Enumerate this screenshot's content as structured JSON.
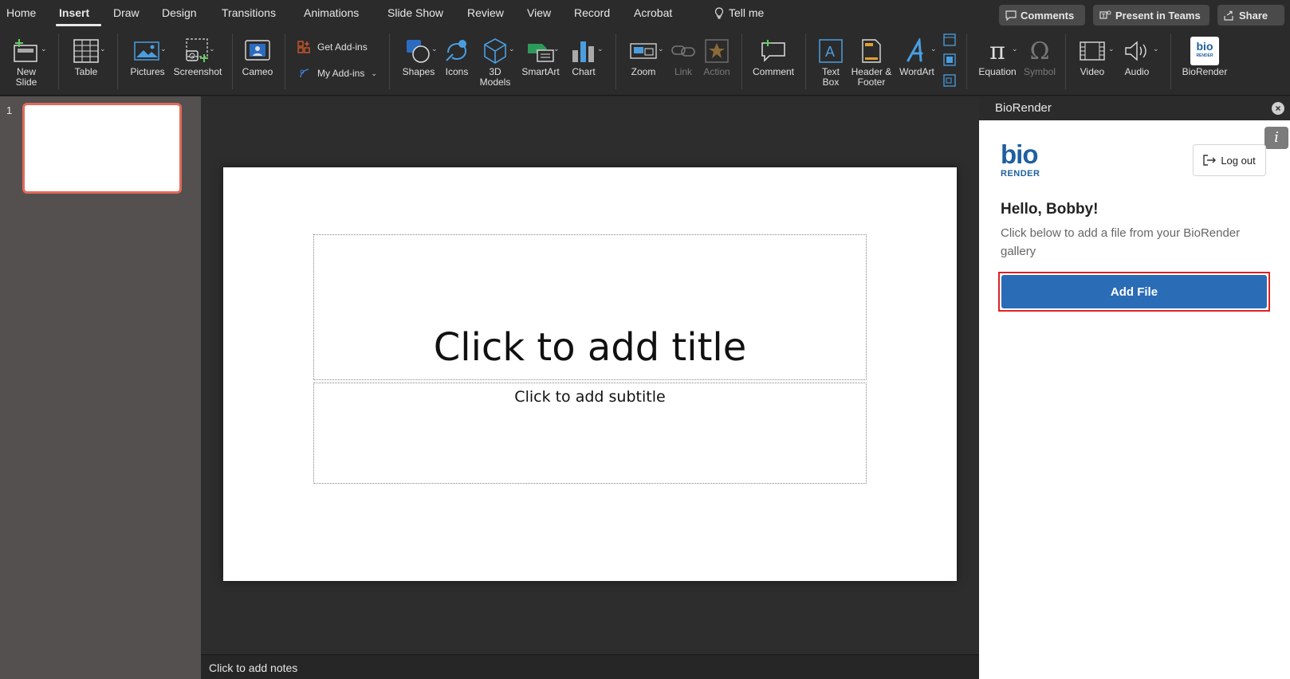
{
  "tabs": [
    "Home",
    "Insert",
    "Draw",
    "Design",
    "Transitions",
    "Animations",
    "Slide Show",
    "Review",
    "View",
    "Record",
    "Acrobat"
  ],
  "tell_me": "Tell me",
  "topbar": {
    "comments": "Comments",
    "present_in_teams": "Present in Teams",
    "share": "Share"
  },
  "ribbon": {
    "new_slide": [
      "New",
      "Slide"
    ],
    "table": "Table",
    "pictures": "Pictures",
    "screenshot": "Screenshot",
    "cameo": "Cameo",
    "get_addins": "Get Add-ins",
    "my_addins": "My Add-ins",
    "shapes": "Shapes",
    "icons": "Icons",
    "models3d": [
      "3D",
      "Models"
    ],
    "smartart": "SmartArt",
    "chart": "Chart",
    "zoom": "Zoom",
    "link": "Link",
    "action": "Action",
    "comment": "Comment",
    "textbox": [
      "Text",
      "Box"
    ],
    "header_footer": [
      "Header &",
      "Footer"
    ],
    "wordart": "WordArt",
    "equation": "Equation",
    "symbol": "Symbol",
    "video": "Video",
    "audio": "Audio",
    "biorender": "BioRender"
  },
  "thumbnail": {
    "number": "1"
  },
  "slide": {
    "title_placeholder": "Click to add title",
    "subtitle_placeholder": "Click to add subtitle"
  },
  "notes_placeholder": "Click to add notes",
  "pane": {
    "title": "BioRender",
    "logo_top": "bio",
    "logo_bottom": "RENDER",
    "logout": "Log out",
    "greeting": "Hello, Bobby!",
    "description": "Click below to add a file from your BioRender gallery",
    "add_file": "Add File"
  },
  "colors": {
    "accent_blue": "#2a6cb5",
    "highlight_red": "#dd2222",
    "thumb_selected": "#e26a5a",
    "brand_blue": "#1f5f9f"
  }
}
